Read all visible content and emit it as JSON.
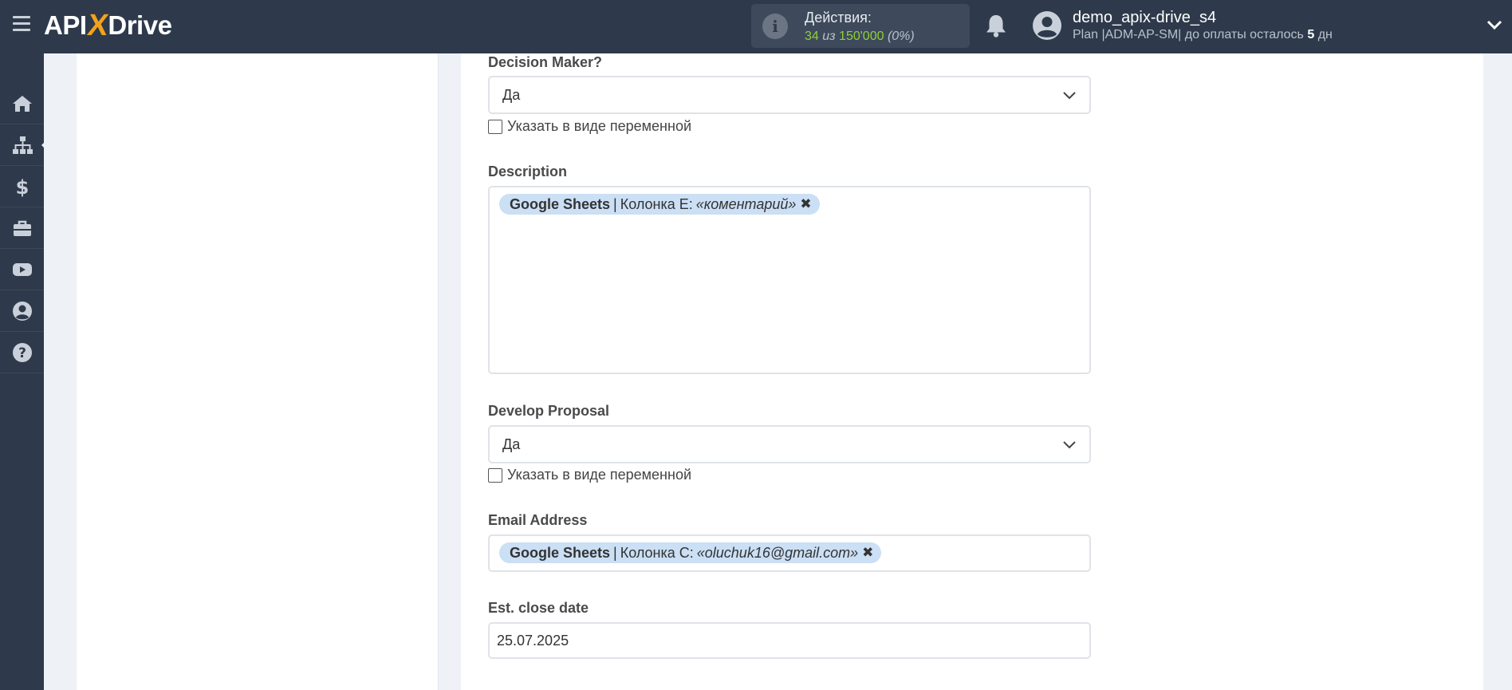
{
  "header": {
    "logo_left": "API",
    "logo_x": "X",
    "logo_right": "Drive",
    "actions_title": "Действия:",
    "actions_used": "34",
    "actions_of": "из",
    "actions_limit": "150'000",
    "actions_percent": "(0%)",
    "username": "demo_apix-drive_s4",
    "plan_text": "Plan |ADM-AP-SM| до оплаты осталось",
    "plan_days": "5",
    "plan_days_unit": "дн"
  },
  "sidebar": {
    "items": [
      "home-icon",
      "sitemap-icon",
      "dollar-icon",
      "briefcase-icon",
      "youtube-icon",
      "user-circle-icon",
      "help-icon"
    ]
  },
  "form": {
    "decision_maker": {
      "label": "Decision Maker?",
      "value": "Да",
      "checkbox_label": "Указать в виде переменной"
    },
    "description": {
      "label": "Description",
      "chip_source": "Google Sheets",
      "chip_sep": "|",
      "chip_column": "Колонка E:",
      "chip_value": "«коментарий»"
    },
    "develop_proposal": {
      "label": "Develop Proposal",
      "value": "Да",
      "checkbox_label": "Указать в виде переменной"
    },
    "email": {
      "label": "Email Address",
      "chip_source": "Google Sheets",
      "chip_sep": "|",
      "chip_column": "Колонка C:",
      "chip_value": "«oluchuk16@gmail.com»"
    },
    "close_date": {
      "label": "Est. close date",
      "value": "25.07.2025"
    }
  }
}
